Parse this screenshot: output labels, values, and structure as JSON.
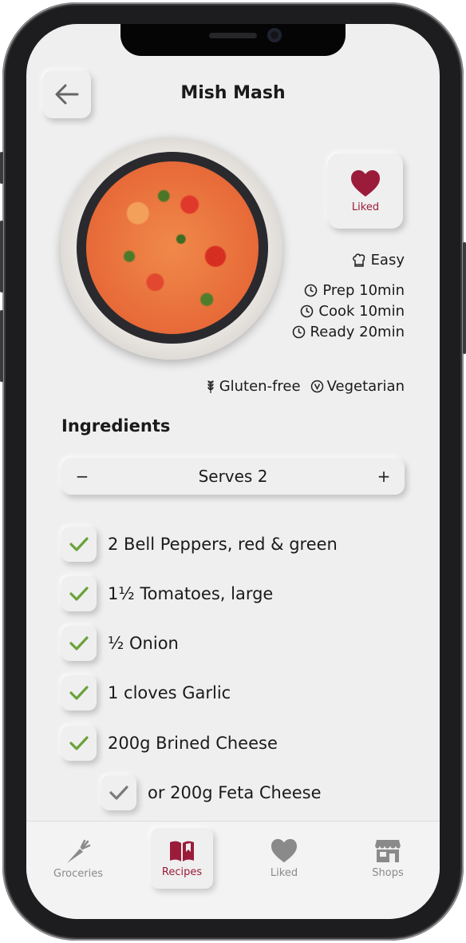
{
  "colors": {
    "accent": "#9b1b3a",
    "check": "#6aa23a",
    "background": "#efefef",
    "inactive": "#8a8a8a"
  },
  "header": {
    "title": "Mish Mash",
    "back_icon": "arrow-left-icon"
  },
  "favorite": {
    "label": "Liked",
    "icon": "heart-icon"
  },
  "meta": {
    "difficulty": "Easy",
    "prep": "Prep 10min",
    "cook": "Cook 10min",
    "ready": "Ready 20min",
    "tags": [
      "Gluten-free",
      "Vegetarian"
    ]
  },
  "ingredients": {
    "title": "Ingredients",
    "serves_label": "Serves 2",
    "minus": "−",
    "plus": "+",
    "items": [
      {
        "text": "2 Bell Peppers, red & green",
        "checked": true
      },
      {
        "text": "1½ Tomatoes, large",
        "checked": true
      },
      {
        "text": "½ Onion",
        "checked": true
      },
      {
        "text": "1 cloves Garlic",
        "checked": true
      },
      {
        "text": "200g Brined Cheese",
        "checked": true
      },
      {
        "text": "or 200g Feta Cheese",
        "checked": true,
        "alternative": true
      }
    ]
  },
  "tabbar": {
    "tabs": [
      {
        "label": "Groceries",
        "icon": "carrot-icon",
        "active": false
      },
      {
        "label": "Recipes",
        "icon": "book-icon",
        "active": true
      },
      {
        "label": "Liked",
        "icon": "heart-icon",
        "active": false
      },
      {
        "label": "Shops",
        "icon": "store-icon",
        "active": false
      }
    ]
  }
}
